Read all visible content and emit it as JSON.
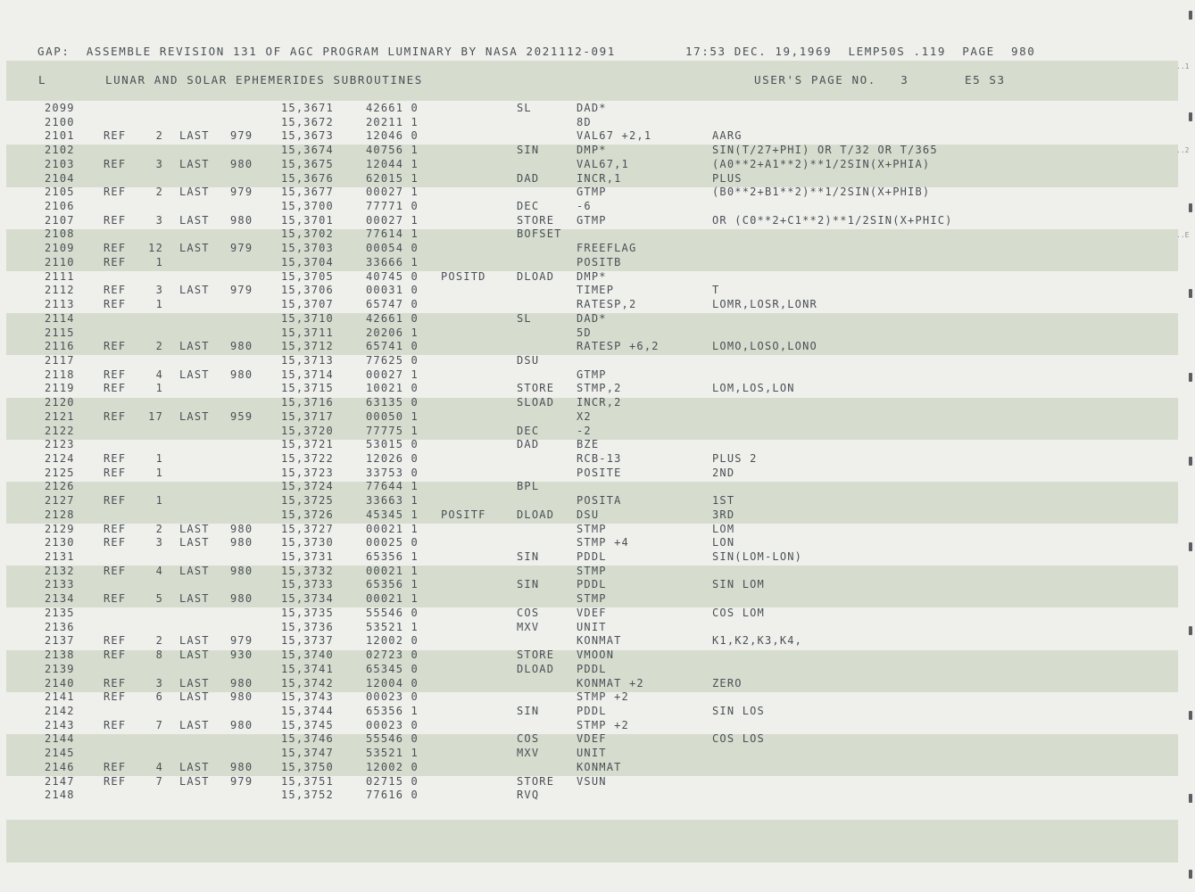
{
  "header": {
    "line1_left": "GAP:  ASSEMBLE REVISION 131 OF AGC PROGRAM LUMINARY BY NASA 2021112-091",
    "line1_right": "17:53 DEC. 19,1969  LEMP50S .119  PAGE  980",
    "section_code": "L",
    "section_title": "LUNAR AND SOLAR EPHEMERIDES SUBROUTINES",
    "users_page": "USER'S PAGE NO.   3",
    "tag": "E5 S3"
  },
  "margin_marks": [
    "..1",
    "..2",
    "..E"
  ],
  "rows": [
    {
      "line": "2099",
      "ref": "",
      "refn": "",
      "last": "",
      "lpage": "",
      "addr": "15,3671",
      "word": "42661 0",
      "label": "",
      "op": "SL",
      "operand": "DAD*",
      "comment": ""
    },
    {
      "line": "2100",
      "ref": "",
      "refn": "",
      "last": "",
      "lpage": "",
      "addr": "15,3672",
      "word": "20211 1",
      "label": "",
      "op": "",
      "operand": "8D",
      "comment": ""
    },
    {
      "line": "2101",
      "ref": "REF",
      "refn": "2",
      "last": "LAST",
      "lpage": "979",
      "addr": "15,3673",
      "word": "12046 0",
      "label": "",
      "op": "",
      "operand": "VAL67 +2,1",
      "comment": "AARG"
    },
    {
      "line": "2102",
      "ref": "",
      "refn": "",
      "last": "",
      "lpage": "",
      "addr": "15,3674",
      "word": "40756 1",
      "label": "",
      "op": "SIN",
      "operand": "DMP*",
      "comment": "SIN(T/27+PHI) OR T/32 OR T/365"
    },
    {
      "line": "2103",
      "ref": "REF",
      "refn": "3",
      "last": "LAST",
      "lpage": "980",
      "addr": "15,3675",
      "word": "12044 1",
      "label": "",
      "op": "",
      "operand": "VAL67,1",
      "comment": "(A0**2+A1**2)**1/2SIN(X+PHIA)"
    },
    {
      "line": "2104",
      "ref": "",
      "refn": "",
      "last": "",
      "lpage": "",
      "addr": "15,3676",
      "word": "62015 1",
      "label": "",
      "op": "DAD",
      "operand": "INCR,1",
      "comment": "PLUS"
    },
    {
      "line": "2105",
      "ref": "REF",
      "refn": "2",
      "last": "LAST",
      "lpage": "979",
      "addr": "15,3677",
      "word": "00027 1",
      "label": "",
      "op": "",
      "operand": "GTMP",
      "comment": "(B0**2+B1**2)**1/2SIN(X+PHIB)"
    },
    {
      "line": "2106",
      "ref": "",
      "refn": "",
      "last": "",
      "lpage": "",
      "addr": "15,3700",
      "word": "77771 0",
      "label": "",
      "op": "DEC",
      "operand": "-6",
      "comment": ""
    },
    {
      "line": "2107",
      "ref": "REF",
      "refn": "3",
      "last": "LAST",
      "lpage": "980",
      "addr": "15,3701",
      "word": "00027 1",
      "label": "",
      "op": "STORE",
      "operand": "GTMP",
      "comment": "OR (C0**2+C1**2)**1/2SIN(X+PHIC)"
    },
    {
      "line": "2108",
      "ref": "",
      "refn": "",
      "last": "",
      "lpage": "",
      "addr": "15,3702",
      "word": "77614 1",
      "label": "",
      "op": "BOFSET",
      "operand": "",
      "comment": ""
    },
    {
      "line": "2109",
      "ref": "REF",
      "refn": "12",
      "last": "LAST",
      "lpage": "979",
      "addr": "15,3703",
      "word": "00054 0",
      "label": "",
      "op": "",
      "operand": "FREEFLAG",
      "comment": ""
    },
    {
      "line": "2110",
      "ref": "REF",
      "refn": "1",
      "last": "",
      "lpage": "",
      "addr": "15,3704",
      "word": "33666 1",
      "label": "",
      "op": "",
      "operand": "POSITB",
      "comment": ""
    },
    {
      "line": "2111",
      "ref": "",
      "refn": "",
      "last": "",
      "lpage": "",
      "addr": "15,3705",
      "word": "40745 0",
      "label": "POSITD",
      "op": "DLOAD",
      "operand": "DMP*",
      "comment": ""
    },
    {
      "line": "2112",
      "ref": "REF",
      "refn": "3",
      "last": "LAST",
      "lpage": "979",
      "addr": "15,3706",
      "word": "00031 0",
      "label": "",
      "op": "",
      "operand": "TIMEP",
      "comment": "T"
    },
    {
      "line": "2113",
      "ref": "REF",
      "refn": "1",
      "last": "",
      "lpage": "",
      "addr": "15,3707",
      "word": "65747 0",
      "label": "",
      "op": "",
      "operand": "RATESP,2",
      "comment": "LOMR,LOSR,LONR"
    },
    {
      "line": "2114",
      "ref": "",
      "refn": "",
      "last": "",
      "lpage": "",
      "addr": "15,3710",
      "word": "42661 0",
      "label": "",
      "op": "SL",
      "operand": "DAD*",
      "comment": ""
    },
    {
      "line": "2115",
      "ref": "",
      "refn": "",
      "last": "",
      "lpage": "",
      "addr": "15,3711",
      "word": "20206 1",
      "label": "",
      "op": "",
      "operand": "5D",
      "comment": ""
    },
    {
      "line": "2116",
      "ref": "REF",
      "refn": "2",
      "last": "LAST",
      "lpage": "980",
      "addr": "15,3712",
      "word": "65741 0",
      "label": "",
      "op": "",
      "operand": "RATESP +6,2",
      "comment": "LOMO,LOSO,LONO"
    },
    {
      "line": "2117",
      "ref": "",
      "refn": "",
      "last": "",
      "lpage": "",
      "addr": "15,3713",
      "word": "77625 0",
      "label": "",
      "op": "DSU",
      "operand": "",
      "comment": ""
    },
    {
      "line": "2118",
      "ref": "REF",
      "refn": "4",
      "last": "LAST",
      "lpage": "980",
      "addr": "15,3714",
      "word": "00027 1",
      "label": "",
      "op": "",
      "operand": "GTMP",
      "comment": ""
    },
    {
      "line": "2119",
      "ref": "REF",
      "refn": "1",
      "last": "",
      "lpage": "",
      "addr": "15,3715",
      "word": "10021 0",
      "label": "",
      "op": "STORE",
      "operand": "STMP,2",
      "comment": "LOM,LOS,LON"
    },
    {
      "line": "2120",
      "ref": "",
      "refn": "",
      "last": "",
      "lpage": "",
      "addr": "15,3716",
      "word": "63135 0",
      "label": "",
      "op": "SLOAD",
      "operand": "INCR,2",
      "comment": ""
    },
    {
      "line": "2121",
      "ref": "REF",
      "refn": "17",
      "last": "LAST",
      "lpage": "959",
      "addr": "15,3717",
      "word": "00050 1",
      "label": "",
      "op": "",
      "operand": "X2",
      "comment": ""
    },
    {
      "line": "2122",
      "ref": "",
      "refn": "",
      "last": "",
      "lpage": "",
      "addr": "15,3720",
      "word": "77775 1",
      "label": "",
      "op": "DEC",
      "operand": "-2",
      "comment": ""
    },
    {
      "line": "2123",
      "ref": "",
      "refn": "",
      "last": "",
      "lpage": "",
      "addr": "15,3721",
      "word": "53015 0",
      "label": "",
      "op": "DAD",
      "operand": "BZE",
      "comment": ""
    },
    {
      "line": "2124",
      "ref": "REF",
      "refn": "1",
      "last": "",
      "lpage": "",
      "addr": "15,3722",
      "word": "12026 0",
      "label": "",
      "op": "",
      "operand": "RCB-13",
      "comment": "PLUS 2"
    },
    {
      "line": "2125",
      "ref": "REF",
      "refn": "1",
      "last": "",
      "lpage": "",
      "addr": "15,3723",
      "word": "33753 0",
      "label": "",
      "op": "",
      "operand": "POSITE",
      "comment": "2ND"
    },
    {
      "line": "2126",
      "ref": "",
      "refn": "",
      "last": "",
      "lpage": "",
      "addr": "15,3724",
      "word": "77644 1",
      "label": "",
      "op": "BPL",
      "operand": "",
      "comment": ""
    },
    {
      "line": "2127",
      "ref": "REF",
      "refn": "1",
      "last": "",
      "lpage": "",
      "addr": "15,3725",
      "word": "33663 1",
      "label": "",
      "op": "",
      "operand": "POSITA",
      "comment": "1ST"
    },
    {
      "line": "2128",
      "ref": "",
      "refn": "",
      "last": "",
      "lpage": "",
      "addr": "15,3726",
      "word": "45345 1",
      "label": "POSITF",
      "op": "DLOAD",
      "operand": "DSU",
      "comment": "3RD"
    },
    {
      "line": "2129",
      "ref": "REF",
      "refn": "2",
      "last": "LAST",
      "lpage": "980",
      "addr": "15,3727",
      "word": "00021 1",
      "label": "",
      "op": "",
      "operand": "STMP",
      "comment": "LOM"
    },
    {
      "line": "2130",
      "ref": "REF",
      "refn": "3",
      "last": "LAST",
      "lpage": "980",
      "addr": "15,3730",
      "word": "00025 0",
      "label": "",
      "op": "",
      "operand": "STMP +4",
      "comment": "LON"
    },
    {
      "line": "2131",
      "ref": "",
      "refn": "",
      "last": "",
      "lpage": "",
      "addr": "15,3731",
      "word": "65356 1",
      "label": "",
      "op": "SIN",
      "operand": "PDDL",
      "comment": "SIN(LOM-LON)"
    },
    {
      "line": "2132",
      "ref": "REF",
      "refn": "4",
      "last": "LAST",
      "lpage": "980",
      "addr": "15,3732",
      "word": "00021 1",
      "label": "",
      "op": "",
      "operand": "STMP",
      "comment": ""
    },
    {
      "line": "2133",
      "ref": "",
      "refn": "",
      "last": "",
      "lpage": "",
      "addr": "15,3733",
      "word": "65356 1",
      "label": "",
      "op": "SIN",
      "operand": "PDDL",
      "comment": "SIN LOM"
    },
    {
      "line": "2134",
      "ref": "REF",
      "refn": "5",
      "last": "LAST",
      "lpage": "980",
      "addr": "15,3734",
      "word": "00021 1",
      "label": "",
      "op": "",
      "operand": "STMP",
      "comment": ""
    },
    {
      "line": "2135",
      "ref": "",
      "refn": "",
      "last": "",
      "lpage": "",
      "addr": "15,3735",
      "word": "55546 0",
      "label": "",
      "op": "COS",
      "operand": "VDEF",
      "comment": "COS LOM"
    },
    {
      "line": "2136",
      "ref": "",
      "refn": "",
      "last": "",
      "lpage": "",
      "addr": "15,3736",
      "word": "53521 1",
      "label": "",
      "op": "MXV",
      "operand": "UNIT",
      "comment": ""
    },
    {
      "line": "2137",
      "ref": "REF",
      "refn": "2",
      "last": "LAST",
      "lpage": "979",
      "addr": "15,3737",
      "word": "12002 0",
      "label": "",
      "op": "",
      "operand": "KONMAT",
      "comment": "K1,K2,K3,K4,"
    },
    {
      "line": "2138",
      "ref": "REF",
      "refn": "8",
      "last": "LAST",
      "lpage": "930",
      "addr": "15,3740",
      "word": "02723 0",
      "label": "",
      "op": "STORE",
      "operand": "VMOON",
      "comment": ""
    },
    {
      "line": "2139",
      "ref": "",
      "refn": "",
      "last": "",
      "lpage": "",
      "addr": "15,3741",
      "word": "65345 0",
      "label": "",
      "op": "DLOAD",
      "operand": "PDDL",
      "comment": ""
    },
    {
      "line": "2140",
      "ref": "REF",
      "refn": "3",
      "last": "LAST",
      "lpage": "980",
      "addr": "15,3742",
      "word": "12004 0",
      "label": "",
      "op": "",
      "operand": "KONMAT +2",
      "comment": "ZERO"
    },
    {
      "line": "2141",
      "ref": "REF",
      "refn": "6",
      "last": "LAST",
      "lpage": "980",
      "addr": "15,3743",
      "word": "00023 0",
      "label": "",
      "op": "",
      "operand": "STMP +2",
      "comment": ""
    },
    {
      "line": "2142",
      "ref": "",
      "refn": "",
      "last": "",
      "lpage": "",
      "addr": "15,3744",
      "word": "65356 1",
      "label": "",
      "op": "SIN",
      "operand": "PDDL",
      "comment": "SIN LOS"
    },
    {
      "line": "2143",
      "ref": "REF",
      "refn": "7",
      "last": "LAST",
      "lpage": "980",
      "addr": "15,3745",
      "word": "00023 0",
      "label": "",
      "op": "",
      "operand": "STMP +2",
      "comment": ""
    },
    {
      "line": "2144",
      "ref": "",
      "refn": "",
      "last": "",
      "lpage": "",
      "addr": "15,3746",
      "word": "55546 0",
      "label": "",
      "op": "COS",
      "operand": "VDEF",
      "comment": "COS LOS"
    },
    {
      "line": "2145",
      "ref": "",
      "refn": "",
      "last": "",
      "lpage": "",
      "addr": "15,3747",
      "word": "53521 1",
      "label": "",
      "op": "MXV",
      "operand": "UNIT",
      "comment": ""
    },
    {
      "line": "2146",
      "ref": "REF",
      "refn": "4",
      "last": "LAST",
      "lpage": "980",
      "addr": "15,3750",
      "word": "12002 0",
      "label": "",
      "op": "",
      "operand": "KONMAT",
      "comment": ""
    },
    {
      "line": "2147",
      "ref": "REF",
      "refn": "7",
      "last": "LAST",
      "lpage": "979",
      "addr": "15,3751",
      "word": "02715 0",
      "label": "",
      "op": "STORE",
      "operand": "VSUN",
      "comment": ""
    },
    {
      "line": "2148",
      "ref": "",
      "refn": "",
      "last": "",
      "lpage": "",
      "addr": "15,3752",
      "word": "77616 0",
      "label": "",
      "op": "RVQ",
      "operand": "",
      "comment": ""
    }
  ]
}
